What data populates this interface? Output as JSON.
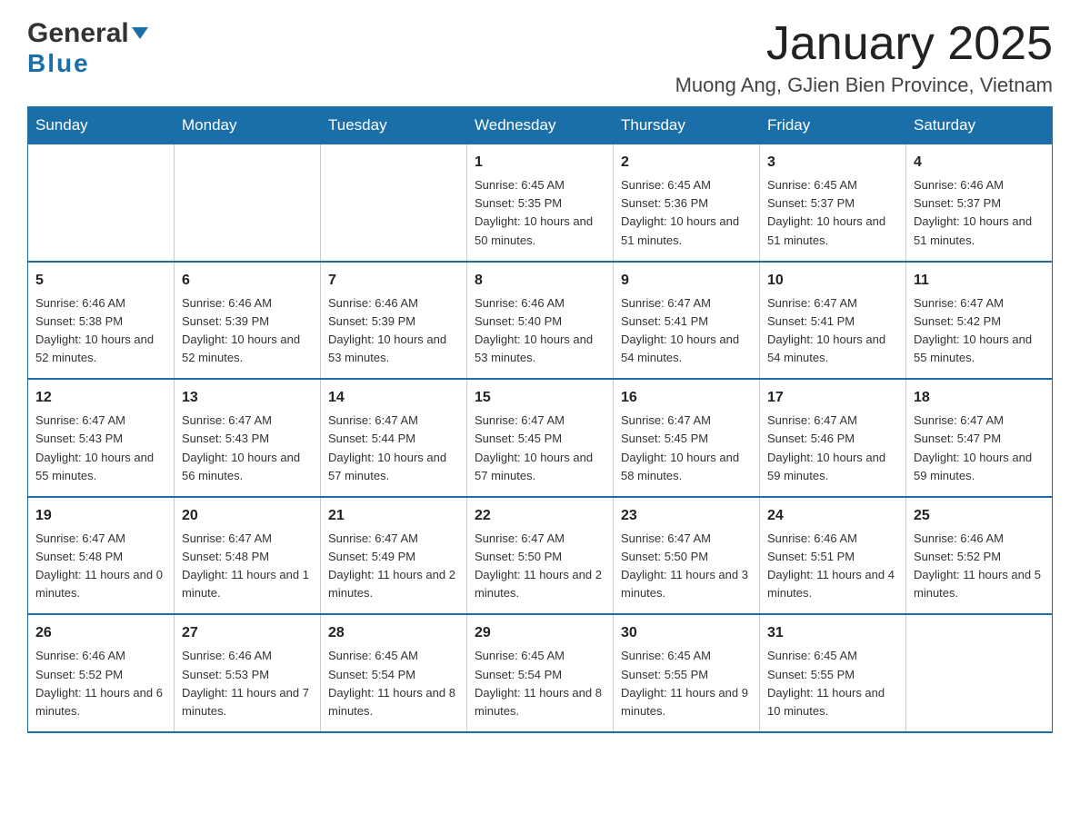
{
  "header": {
    "logo_general": "General",
    "logo_blue": "Blue",
    "month_title": "January 2025",
    "location": "Muong Ang, GJien Bien Province, Vietnam"
  },
  "days_of_week": [
    "Sunday",
    "Monday",
    "Tuesday",
    "Wednesday",
    "Thursday",
    "Friday",
    "Saturday"
  ],
  "weeks": [
    {
      "days": [
        {
          "num": "",
          "info": ""
        },
        {
          "num": "",
          "info": ""
        },
        {
          "num": "",
          "info": ""
        },
        {
          "num": "1",
          "info": "Sunrise: 6:45 AM\nSunset: 5:35 PM\nDaylight: 10 hours and 50 minutes."
        },
        {
          "num": "2",
          "info": "Sunrise: 6:45 AM\nSunset: 5:36 PM\nDaylight: 10 hours and 51 minutes."
        },
        {
          "num": "3",
          "info": "Sunrise: 6:45 AM\nSunset: 5:37 PM\nDaylight: 10 hours and 51 minutes."
        },
        {
          "num": "4",
          "info": "Sunrise: 6:46 AM\nSunset: 5:37 PM\nDaylight: 10 hours and 51 minutes."
        }
      ]
    },
    {
      "days": [
        {
          "num": "5",
          "info": "Sunrise: 6:46 AM\nSunset: 5:38 PM\nDaylight: 10 hours and 52 minutes."
        },
        {
          "num": "6",
          "info": "Sunrise: 6:46 AM\nSunset: 5:39 PM\nDaylight: 10 hours and 52 minutes."
        },
        {
          "num": "7",
          "info": "Sunrise: 6:46 AM\nSunset: 5:39 PM\nDaylight: 10 hours and 53 minutes."
        },
        {
          "num": "8",
          "info": "Sunrise: 6:46 AM\nSunset: 5:40 PM\nDaylight: 10 hours and 53 minutes."
        },
        {
          "num": "9",
          "info": "Sunrise: 6:47 AM\nSunset: 5:41 PM\nDaylight: 10 hours and 54 minutes."
        },
        {
          "num": "10",
          "info": "Sunrise: 6:47 AM\nSunset: 5:41 PM\nDaylight: 10 hours and 54 minutes."
        },
        {
          "num": "11",
          "info": "Sunrise: 6:47 AM\nSunset: 5:42 PM\nDaylight: 10 hours and 55 minutes."
        }
      ]
    },
    {
      "days": [
        {
          "num": "12",
          "info": "Sunrise: 6:47 AM\nSunset: 5:43 PM\nDaylight: 10 hours and 55 minutes."
        },
        {
          "num": "13",
          "info": "Sunrise: 6:47 AM\nSunset: 5:43 PM\nDaylight: 10 hours and 56 minutes."
        },
        {
          "num": "14",
          "info": "Sunrise: 6:47 AM\nSunset: 5:44 PM\nDaylight: 10 hours and 57 minutes."
        },
        {
          "num": "15",
          "info": "Sunrise: 6:47 AM\nSunset: 5:45 PM\nDaylight: 10 hours and 57 minutes."
        },
        {
          "num": "16",
          "info": "Sunrise: 6:47 AM\nSunset: 5:45 PM\nDaylight: 10 hours and 58 minutes."
        },
        {
          "num": "17",
          "info": "Sunrise: 6:47 AM\nSunset: 5:46 PM\nDaylight: 10 hours and 59 minutes."
        },
        {
          "num": "18",
          "info": "Sunrise: 6:47 AM\nSunset: 5:47 PM\nDaylight: 10 hours and 59 minutes."
        }
      ]
    },
    {
      "days": [
        {
          "num": "19",
          "info": "Sunrise: 6:47 AM\nSunset: 5:48 PM\nDaylight: 11 hours and 0 minutes."
        },
        {
          "num": "20",
          "info": "Sunrise: 6:47 AM\nSunset: 5:48 PM\nDaylight: 11 hours and 1 minute."
        },
        {
          "num": "21",
          "info": "Sunrise: 6:47 AM\nSunset: 5:49 PM\nDaylight: 11 hours and 2 minutes."
        },
        {
          "num": "22",
          "info": "Sunrise: 6:47 AM\nSunset: 5:50 PM\nDaylight: 11 hours and 2 minutes."
        },
        {
          "num": "23",
          "info": "Sunrise: 6:47 AM\nSunset: 5:50 PM\nDaylight: 11 hours and 3 minutes."
        },
        {
          "num": "24",
          "info": "Sunrise: 6:46 AM\nSunset: 5:51 PM\nDaylight: 11 hours and 4 minutes."
        },
        {
          "num": "25",
          "info": "Sunrise: 6:46 AM\nSunset: 5:52 PM\nDaylight: 11 hours and 5 minutes."
        }
      ]
    },
    {
      "days": [
        {
          "num": "26",
          "info": "Sunrise: 6:46 AM\nSunset: 5:52 PM\nDaylight: 11 hours and 6 minutes."
        },
        {
          "num": "27",
          "info": "Sunrise: 6:46 AM\nSunset: 5:53 PM\nDaylight: 11 hours and 7 minutes."
        },
        {
          "num": "28",
          "info": "Sunrise: 6:45 AM\nSunset: 5:54 PM\nDaylight: 11 hours and 8 minutes."
        },
        {
          "num": "29",
          "info": "Sunrise: 6:45 AM\nSunset: 5:54 PM\nDaylight: 11 hours and 8 minutes."
        },
        {
          "num": "30",
          "info": "Sunrise: 6:45 AM\nSunset: 5:55 PM\nDaylight: 11 hours and 9 minutes."
        },
        {
          "num": "31",
          "info": "Sunrise: 6:45 AM\nSunset: 5:55 PM\nDaylight: 11 hours and 10 minutes."
        },
        {
          "num": "",
          "info": ""
        }
      ]
    }
  ]
}
